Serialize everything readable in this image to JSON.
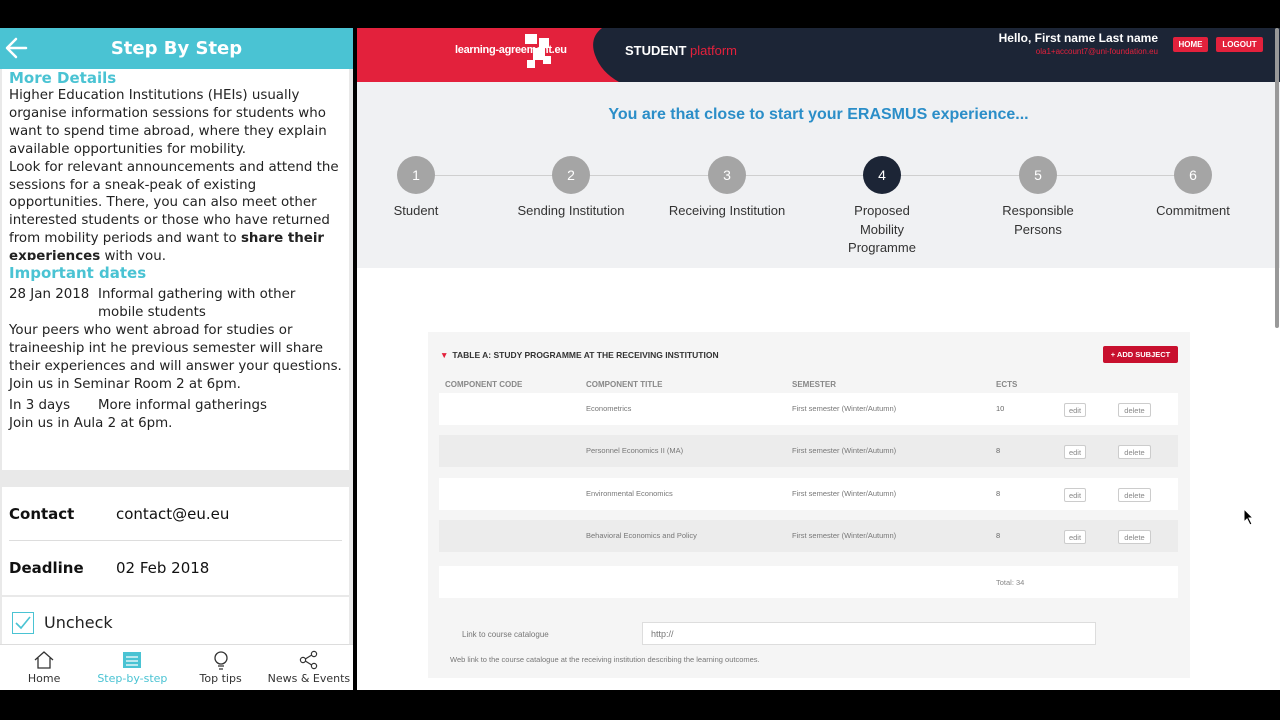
{
  "mobile": {
    "title": "Step By Step",
    "more_details": {
      "heading": "More Details",
      "p1": "Higher Education Institutions (HEIs) usually organise information sessions for students who want to spend time abroad, where they explain available opportunities for mobility.",
      "p2_a": "Look for relevant announcements and attend the sessions for a sneak-peak of existing opportunities. There, you can also meet other interested students or those who have returned from mobility periods and want to ",
      "p2_bold": "share their experiences",
      "p2_b": " with you."
    },
    "important_dates": {
      "heading": "Important dates",
      "e1_date": "28 Jan 2018",
      "e1_title": "Informal gathering with other mobile students",
      "e1_text": "Your peers who went abroad for studies or traineeship int he previous semester will share their experiences and will answer your questions. Join us in Seminar Room 2 at 6pm.",
      "e2_date": "In 3 days",
      "e2_title": "More informal gatherings",
      "e2_text": "Join us in Aula 2 at 6pm."
    },
    "contact_label": "Contact",
    "contact_value": "contact@eu.eu",
    "deadline_label": "Deadline",
    "deadline_value": "02 Feb 2018",
    "uncheck_label": "Uncheck",
    "tabs": [
      {
        "label": "Home",
        "icon": "home-icon"
      },
      {
        "label": "Step-by-step",
        "icon": "list-icon"
      },
      {
        "label": "Top tips",
        "icon": "lightbulb-icon"
      },
      {
        "label": "News & Events",
        "icon": "share-icon"
      }
    ],
    "accent": "#4ac3d3"
  },
  "web": {
    "logo_text": "learning-agreement.eu",
    "platform_a": "STUDENT",
    "platform_b": "platform",
    "hello": "Hello, First name Last name",
    "email": "ola1+account7@uni-foundation.eu",
    "home_btn": "HOME",
    "logout_btn": "LOGOUT",
    "tagline": "You are that close to start your ERASMUS experience...",
    "steps": [
      {
        "num": "1",
        "label": "Student"
      },
      {
        "num": "2",
        "label": "Sending Institution"
      },
      {
        "num": "3",
        "label": "Receiving Institution"
      },
      {
        "num": "4",
        "label": "Proposed Mobility Programme"
      },
      {
        "num": "5",
        "label": "Responsible Persons"
      },
      {
        "num": "6",
        "label": "Commitment"
      }
    ],
    "active_step": 4,
    "table": {
      "title": "TABLE A: STUDY PROGRAMME AT THE RECEIVING INSTITUTION",
      "add_btn": "+ ADD SUBJECT",
      "headers": [
        "COMPONENT CODE",
        "COMPONENT TITLE",
        "SEMESTER",
        "ECTS"
      ],
      "rows": [
        {
          "code": "",
          "title": "Econometrics",
          "semester": "First semester (Winter/Autumn)",
          "ects": "10"
        },
        {
          "code": "",
          "title": "Personnel Economics II (MA)",
          "semester": "First semester (Winter/Autumn)",
          "ects": "8"
        },
        {
          "code": "",
          "title": "Environmental Economics",
          "semester": "First semester (Winter/Autumn)",
          "ects": "8"
        },
        {
          "code": "",
          "title": "Behavioral Economics and Policy",
          "semester": "First semester (Winter/Autumn)",
          "ects": "8"
        }
      ],
      "edit_label": "edit",
      "delete_label": "delete",
      "total": "Total: 34"
    },
    "link_label": "Link to course catalogue",
    "link_placeholder": "http://",
    "link_hint": "Web link to the course catalogue at the receiving institution describing the learning outcomes.",
    "brand_red": "#e3213c",
    "navy": "#1c2536",
    "tagline_blue": "#2b8ec8"
  }
}
